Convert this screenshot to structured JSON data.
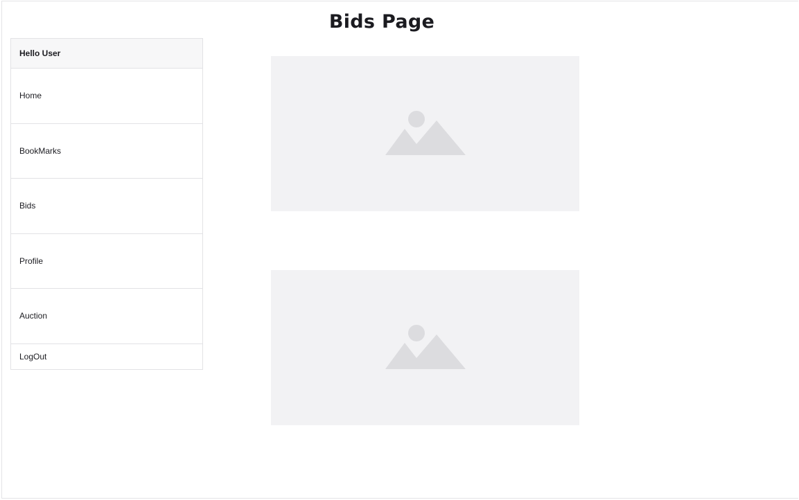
{
  "page": {
    "title": "Bids Page"
  },
  "sidebar": {
    "greeting": "Hello User",
    "items": [
      {
        "label": "Home"
      },
      {
        "label": "BookMarks"
      },
      {
        "label": "Bids"
      },
      {
        "label": "Profile"
      },
      {
        "label": "Auction"
      },
      {
        "label": "LogOut"
      }
    ]
  },
  "content": {
    "images": [
      {
        "icon": "image-placeholder-icon"
      },
      {
        "icon": "image-placeholder-icon"
      }
    ]
  },
  "colors": {
    "placeholder_bg": "#f2f2f4",
    "placeholder_icon": "#dcdcdf",
    "border": "#e2e2e5",
    "text": "#1b1b20"
  }
}
